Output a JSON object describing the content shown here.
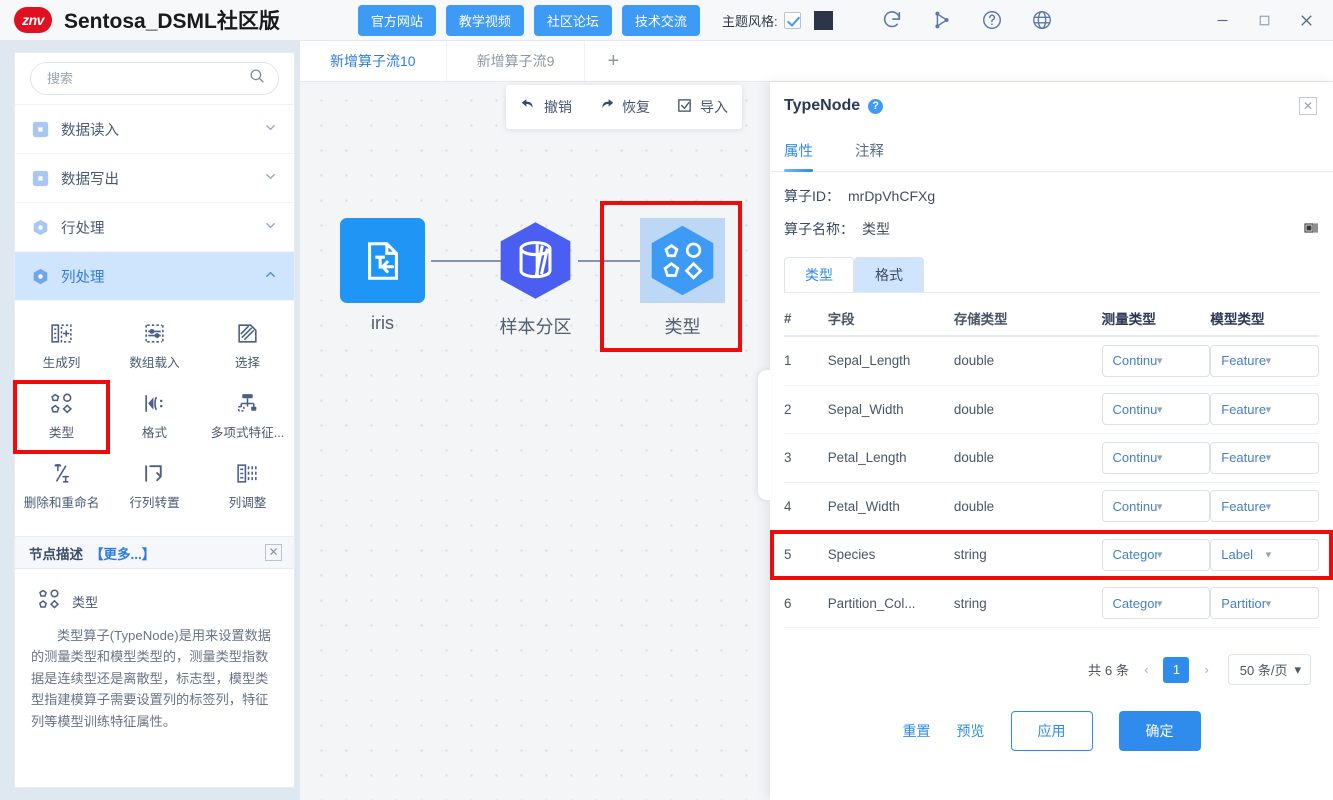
{
  "header": {
    "logo_text": "znv",
    "title": "Sentosa_DSML社区版",
    "buttons": [
      {
        "label": "官方网站",
        "name": "official-site-button"
      },
      {
        "label": "教学视频",
        "name": "tutorial-video-button"
      },
      {
        "label": "社区论坛",
        "name": "community-forum-button"
      },
      {
        "label": "技术交流",
        "name": "tech-exchange-button"
      }
    ],
    "theme_label": "主题风格:",
    "theme_checked": true,
    "theme_swatch_color": "#2c3648",
    "accent_color": "#3d9bf5"
  },
  "sidebar": {
    "search_placeholder": "搜索",
    "search_value": "",
    "categories": [
      {
        "label": "数据读入",
        "expanded": false
      },
      {
        "label": "数据写出",
        "expanded": false
      },
      {
        "label": "行处理",
        "expanded": false
      },
      {
        "label": "列处理",
        "expanded": true
      }
    ],
    "tools": [
      {
        "label": "生成列",
        "selected": false
      },
      {
        "label": "数组载入",
        "selected": false
      },
      {
        "label": "选择",
        "selected": false
      },
      {
        "label": "类型",
        "selected": true
      },
      {
        "label": "格式",
        "selected": false
      },
      {
        "label": "多项式特征...",
        "selected": false
      },
      {
        "label": "删除和重命名",
        "selected": false
      },
      {
        "label": "行列转置",
        "selected": false
      },
      {
        "label": "列调整",
        "selected": false
      }
    ],
    "description": {
      "title": "节点描述",
      "more": "【更多...】",
      "node_name": "类型",
      "body": "类型算子(TypeNode)是用来设置数据的测量类型和模型类型的，测量类型指数据是连续型还是离散型，标志型，模型类型指建模算子需要设置列的标签列，特征列等模型训练特征属性。"
    }
  },
  "canvas": {
    "tabs": [
      {
        "label": "新增算子流10",
        "active": true
      },
      {
        "label": "新增算子流9",
        "active": false
      }
    ],
    "add_tab": "+",
    "toolbar": [
      {
        "label": "撤销",
        "name": "undo-button"
      },
      {
        "label": "恢复",
        "name": "redo-button"
      },
      {
        "label": "导入",
        "name": "import-button"
      }
    ],
    "nodes": [
      {
        "label": "iris",
        "type": "source",
        "selected": false
      },
      {
        "label": "样本分区",
        "type": "partition",
        "selected": false
      },
      {
        "label": "类型",
        "type": "typenode",
        "selected": true
      }
    ]
  },
  "panel": {
    "title": "TypeNode",
    "help": "?",
    "close": "✕",
    "tabs": [
      {
        "label": "属性",
        "active": true
      },
      {
        "label": "注释",
        "active": false
      }
    ],
    "operator_id_key": "算子ID：",
    "operator_id_value": "mrDpVhCFXg",
    "operator_name_key": "算子名称：",
    "operator_name_value": "类型",
    "sub_tabs": [
      {
        "label": "类型",
        "active": true
      },
      {
        "label": "格式",
        "active": false
      }
    ],
    "table": {
      "headers": [
        "#",
        "字段",
        "存储类型",
        "测量类型",
        "模型类型"
      ],
      "rows": [
        {
          "idx": "1",
          "field": "Sepal_Length",
          "store": "double",
          "measure": "Continuous",
          "model": "Feature",
          "highlighted": false
        },
        {
          "idx": "2",
          "field": "Sepal_Width",
          "store": "double",
          "measure": "Continuous",
          "model": "Feature",
          "highlighted": false
        },
        {
          "idx": "3",
          "field": "Petal_Length",
          "store": "double",
          "measure": "Continuous",
          "model": "Feature",
          "highlighted": false
        },
        {
          "idx": "4",
          "field": "Petal_Width",
          "store": "double",
          "measure": "Continuous",
          "model": "Feature",
          "highlighted": false
        },
        {
          "idx": "5",
          "field": "Species",
          "store": "string",
          "measure": "Categorical",
          "model": "Label",
          "highlighted": true
        },
        {
          "idx": "6",
          "field": "Partition_Col...",
          "store": "string",
          "measure": "Categorical",
          "model": "Partition",
          "highlighted": false
        }
      ]
    },
    "pagination": {
      "total": "共 6 条",
      "prev": "‹",
      "next": "›",
      "current_page": "1",
      "page_size": "50 条/页"
    },
    "footer": [
      {
        "label": "重置",
        "style": "link",
        "name": "reset-button"
      },
      {
        "label": "预览",
        "style": "link",
        "name": "preview-button"
      },
      {
        "label": "应用",
        "style": "outline",
        "name": "apply-button"
      },
      {
        "label": "确定",
        "style": "fill",
        "name": "confirm-button"
      }
    ]
  }
}
